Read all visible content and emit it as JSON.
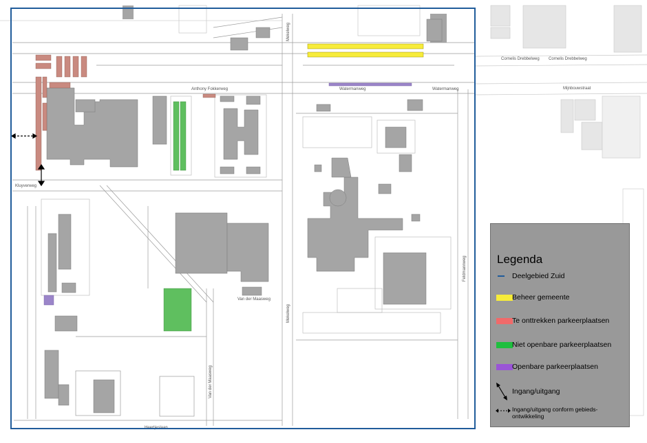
{
  "map": {
    "colors": {
      "background": "#ffffff",
      "building": "#a5a5a5",
      "building_light": "#d2d2d2",
      "road_line": "#9a9a9a",
      "boundary": "#1f5b9a",
      "beheer_gemeente": "#f7ec3a",
      "te_onttrekken": "#c98a80",
      "niet_openbaar": "#5fbf5f",
      "openbaar": "#9b85c9"
    },
    "streets": {
      "anthony_fokkerweg": "Anthony Fokkerweg",
      "watermanweg_1": "Watermanweg",
      "watermanweg_2": "Watermanweg",
      "kluyverweg": "Kluyverweg",
      "mekelweg_top": "Mekelweg",
      "mekelweg_mid": "Mekelweg",
      "van_der_maasweg_1": "Van der Maasweg",
      "van_der_maasweg_2": "Van der Maasweg",
      "heertjeslaan": "Heertjeslaan",
      "cornelis_street_1": "Cornelis Drebbelweg",
      "cornelis_street_2": "Cornelis Drebbelweg",
      "feldmannweg": "Feldmannweg",
      "mijnbouwstraat": "Mijnbouwstraat"
    }
  },
  "legend": {
    "title": "Legenda",
    "items": [
      {
        "label": "Deelgebied Zuid",
        "color": "#1f5b9a",
        "kind": "line"
      },
      {
        "label": "Beheer gemeente",
        "color": "#f7ec3a",
        "kind": "swatch"
      },
      {
        "label": "Te onttrekken parkeerplaatsen",
        "color": "#f06a6a",
        "kind": "swatch"
      },
      {
        "label": "Niet openbare parkeerplaatsen",
        "color": "#1fbf3f",
        "kind": "swatch"
      },
      {
        "label": "Openbare parkeerplaatsen",
        "color": "#9a55d6",
        "kind": "swatch"
      },
      {
        "label": "Ingang/uitgang",
        "icon": "two-way-arrow-icon"
      },
      {
        "label_line1": "Ingang/uitgang conform gebieds-",
        "label_line2": "ontwikkeling",
        "icon": "dashed-arrow-icon"
      }
    ]
  }
}
